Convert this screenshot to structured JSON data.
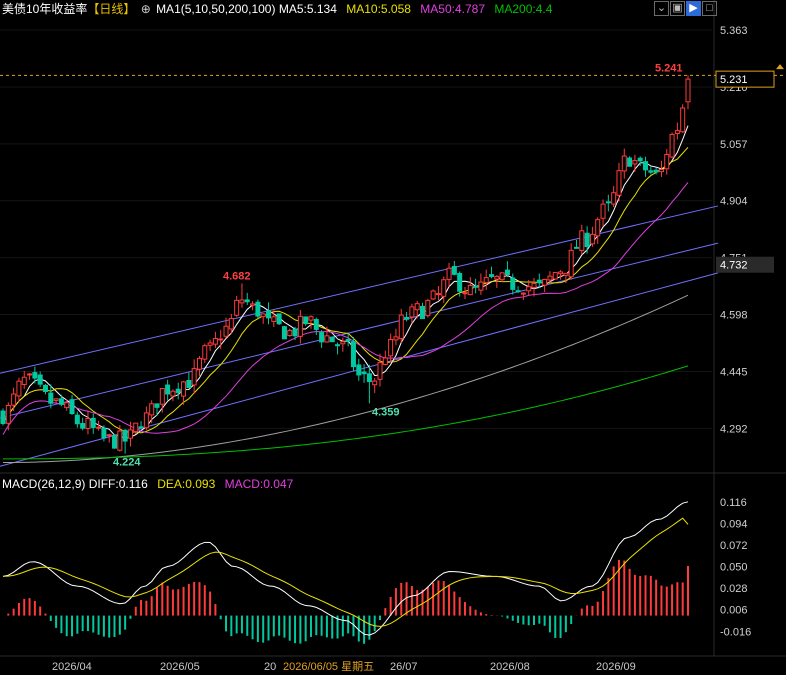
{
  "header": {
    "title": "美债10年收益率",
    "period": "【日线】",
    "ma_label": "MA1(5,10,50,200,100)",
    "ma5": "MA5:5.134",
    "ma10": "MA10:5.058",
    "ma50": "MA50:4.787",
    "ma200": "MA200:4.4",
    "icons": [
      "target-icon",
      "dropdown-icon",
      "restore-icon",
      "window-icon",
      "play-icon",
      "close-icon"
    ]
  },
  "macd_header": {
    "label": "MACD(26,12,9)",
    "diff": "DIFF:0.116",
    "dea": "DEA:0.093",
    "macd": "MACD:0.047"
  },
  "colors": {
    "up": "#ff3b3b",
    "down": "#00c8a0",
    "ma5": "#ffffff",
    "ma10": "#e8e000",
    "ma50": "#e040e0",
    "ma200": "#00c000",
    "ma100": "#a0a0a0",
    "channel": "#7070ff",
    "diff": "#ffffff",
    "dea": "#e8e000"
  },
  "chart_data": {
    "type": "candlestick",
    "price_axis": [
      "5.363",
      "5.210",
      "5.057",
      "4.904",
      "4.751",
      "4.598",
      "4.445",
      "4.292"
    ],
    "price_range": [
      4.18,
      5.39
    ],
    "highlights": {
      "current_price": "5.231",
      "channel_price": "4.732",
      "high": "5.241",
      "swing_high": "4.682",
      "swing_low_1": "4.224",
      "swing_low_2": "4.359"
    },
    "macd_axis": [
      "0.116",
      "0.094",
      "0.072",
      "0.050",
      "0.028",
      "0.006",
      "-0.016"
    ],
    "macd_range": [
      -0.03,
      0.126
    ],
    "x_labels": [
      "2026/04",
      "2026/05",
      "20",
      "2026/06/05 星期五",
      "26/07",
      "2026/08",
      "2026/09"
    ],
    "candles_summary": {
      "count": 130,
      "start": 4.31,
      "swing_low_1": 4.224,
      "swing_high": 4.682,
      "swing_low_2": 4.359,
      "last_high": 5.241,
      "last_close": 5.231
    }
  }
}
